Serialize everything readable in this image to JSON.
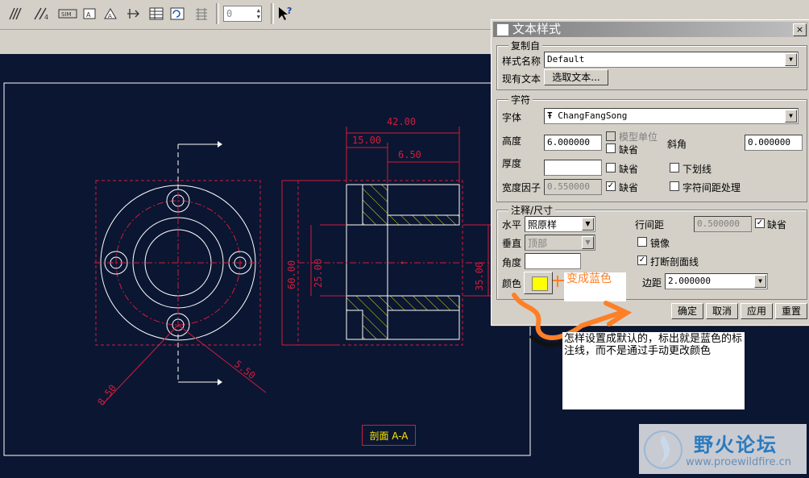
{
  "toolbar": {
    "icons": [
      "hatch-icon",
      "slash-hatch-icon",
      "dimension-icon",
      "note-icon",
      "datum-icon",
      "move-icon",
      "table-icon",
      "repeat-icon",
      "grid-icon",
      "help-cursor-icon"
    ],
    "spin_value": "0"
  },
  "drawing": {
    "dim_top": "42.00",
    "dim_15": "15.00",
    "dim_6": "6.50",
    "dim_60": "60.00",
    "dim_25": "25.00",
    "dim_35": "35.00",
    "dim_8_5": "8.50",
    "dim_5_5": "5.50",
    "section_label": "剖面 A-A",
    "colors": {
      "geometry": "#ffffff",
      "dims": "#d01c3c",
      "hatch": "#e8e800",
      "section_text": "#ffe600"
    }
  },
  "dialog": {
    "title": "文本样式",
    "close": "×",
    "copy_from": {
      "group": "复制自",
      "style_name_label": "样式名称",
      "style_name_value": "Default",
      "existing_text_label": "现有文本",
      "select_text_button": "选取文本..."
    },
    "char": {
      "group": "字符",
      "font_label": "字体",
      "font_value": "ChangFangSong",
      "font_icon": "Ŧ",
      "height_label": "高度",
      "height_value": "6.000000",
      "model_units_label": "模型单位",
      "default_label": "缺省",
      "slant_label": "斜角",
      "slant_value": "0.000000",
      "thickness_label": "厚度",
      "thickness_value": "",
      "thickness_default_label": "缺省",
      "underline_label": "下划线",
      "width_factor_label": "宽度因子",
      "width_factor_value": "0.550000",
      "width_default_label": "缺省",
      "kerning_label": "字符间距处理"
    },
    "note": {
      "group": "注释/尺寸",
      "horizontal_label": "水平",
      "horizontal_value": "照原样",
      "vertical_label": "垂直",
      "vertical_value": "顶部",
      "angle_label": "角度",
      "angle_value": "",
      "color_label": "颜色",
      "line_spacing_label": "行间距",
      "line_spacing_value": "0.500000",
      "line_spacing_default_label": "缺省",
      "mirror_label": "镜像",
      "break_hatch_label": "打断剖面线",
      "margin_label": "边距",
      "margin_value": "2.000000",
      "color_value": "#ffff00"
    },
    "buttons": {
      "ok": "确定",
      "cancel": "取消",
      "apply": "应用",
      "reset": "重置"
    }
  },
  "annotations": {
    "arrow_note": "变成蓝色",
    "question": "怎样设置成默认的，标出就是蓝色的标注线，而不是通过手动更改颜色"
  },
  "watermark": {
    "name": "野火论坛",
    "url": "www.proewildfire.cn"
  }
}
